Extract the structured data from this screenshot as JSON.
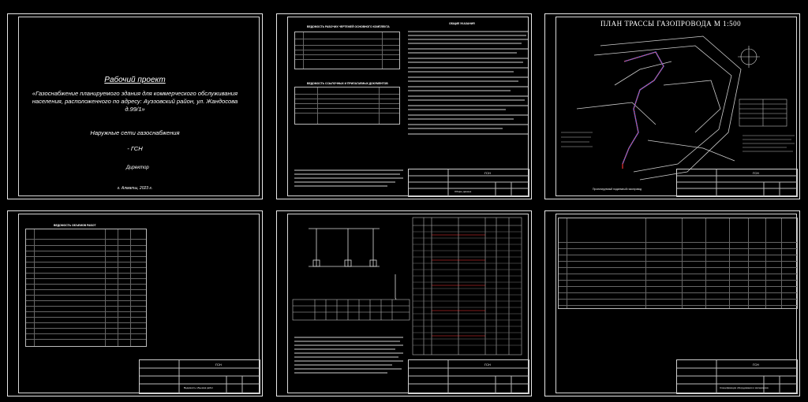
{
  "cover": {
    "title": "Рабочий проект",
    "subject": "«Газоснабжение планируемого здания для коммерческого обслуживания населения, расположенного по адресу: Ауэзовский район, ул. Жандосова д.99/1»",
    "section": "Наружные сети газоснабжения",
    "code": "- ГСН",
    "director": "Директор",
    "city_year": "г. Алматы, 2023 г."
  },
  "sheet2": {
    "title": "ВЕДОМОСТЬ РАБОЧИХ ЧЕРТЕЖЕЙ ОСНОВНОГО КОМПЛЕКТА",
    "refs_title": "ВЕДОМОСТЬ ССЫЛОЧНЫХ И ПРИЛАГАЕМЫХ ДОКУМЕНТОВ",
    "notes_title": "ОБЩИЕ УКАЗАНИЯ",
    "stamp_code": "ГСН",
    "stamp_caption": "Общие данные"
  },
  "sheet3": {
    "title": "ПЛАН ТРАССЫ ГАЗОПРОВОДА М 1:500",
    "stamp_code": "ГСН",
    "caption": "Проектируемый подземный газопровод"
  },
  "sheet4": {
    "title": "ВЕДОМОСТЬ ОБЪЕМОВ РАБОТ",
    "stamp_code": "ГСН",
    "caption": "Ведомость объемов работ"
  },
  "sheet5": {
    "stamp_code": "ГСН"
  },
  "sheet6": {
    "stamp_code": "ГСН",
    "caption": "Спецификация оборудования и материалов"
  }
}
